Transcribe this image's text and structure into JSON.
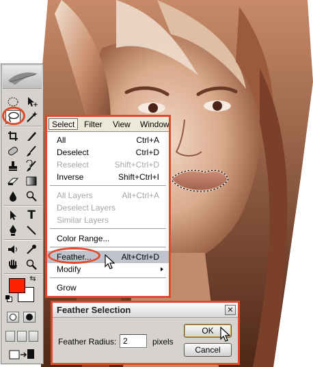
{
  "colors": {
    "accent_annotation": "#e0492a",
    "foreground_color": "#ff2200",
    "menu_highlight": "#bfc4cc"
  },
  "toolbox": {
    "tools": [
      {
        "name": "marquee-tool-icon"
      },
      {
        "name": "move-tool-icon"
      },
      {
        "name": "lasso-tool-icon",
        "selected": true
      },
      {
        "name": "magic-wand-tool-icon"
      },
      {
        "name": "crop-tool-icon"
      },
      {
        "name": "slice-tool-icon"
      },
      {
        "name": "healing-brush-tool-icon"
      },
      {
        "name": "brush-tool-icon"
      },
      {
        "name": "clone-stamp-tool-icon"
      },
      {
        "name": "history-brush-tool-icon"
      },
      {
        "name": "eraser-tool-icon"
      },
      {
        "name": "gradient-tool-icon"
      },
      {
        "name": "blur-tool-icon"
      },
      {
        "name": "dodge-tool-icon"
      },
      {
        "name": "path-selection-tool-icon"
      },
      {
        "name": "type-tool-icon"
      },
      {
        "name": "pen-tool-icon"
      },
      {
        "name": "line-tool-icon"
      },
      {
        "name": "notes-tool-icon"
      },
      {
        "name": "eyedropper-tool-icon"
      },
      {
        "name": "hand-tool-icon"
      },
      {
        "name": "zoom-tool-icon"
      }
    ]
  },
  "menubar": {
    "items": [
      {
        "label": "Select",
        "active": true
      },
      {
        "label": "Filter"
      },
      {
        "label": "View"
      },
      {
        "label": "Window"
      }
    ]
  },
  "select_menu": {
    "items": [
      {
        "label": "All",
        "shortcut": "Ctrl+A",
        "enabled": true
      },
      {
        "label": "Deselect",
        "shortcut": "Ctrl+D",
        "enabled": true
      },
      {
        "label": "Reselect",
        "shortcut": "Shift+Ctrl+D",
        "enabled": false
      },
      {
        "label": "Inverse",
        "shortcut": "Shift+Ctrl+I",
        "enabled": true
      },
      {
        "label": "All Layers",
        "shortcut": "Alt+Ctrl+A",
        "enabled": false
      },
      {
        "label": "Deselect Layers",
        "shortcut": "",
        "enabled": false
      },
      {
        "label": "Similar Layers",
        "shortcut": "",
        "enabled": false
      },
      {
        "label": "Color Range...",
        "shortcut": "",
        "enabled": true
      },
      {
        "label": "Feather...",
        "shortcut": "Alt+Ctrl+D",
        "enabled": true,
        "highlighted": true
      },
      {
        "label": "Modify",
        "shortcut": "",
        "enabled": true,
        "submenu": true
      },
      {
        "label": "Grow",
        "shortcut": "",
        "enabled": true
      }
    ]
  },
  "feather_dialog": {
    "title": "Feather Selection",
    "label": "Feather Radius:",
    "value": "2",
    "unit": "pixels",
    "ok_label": "OK",
    "cancel_label": "Cancel",
    "close_glyph": "✕"
  }
}
